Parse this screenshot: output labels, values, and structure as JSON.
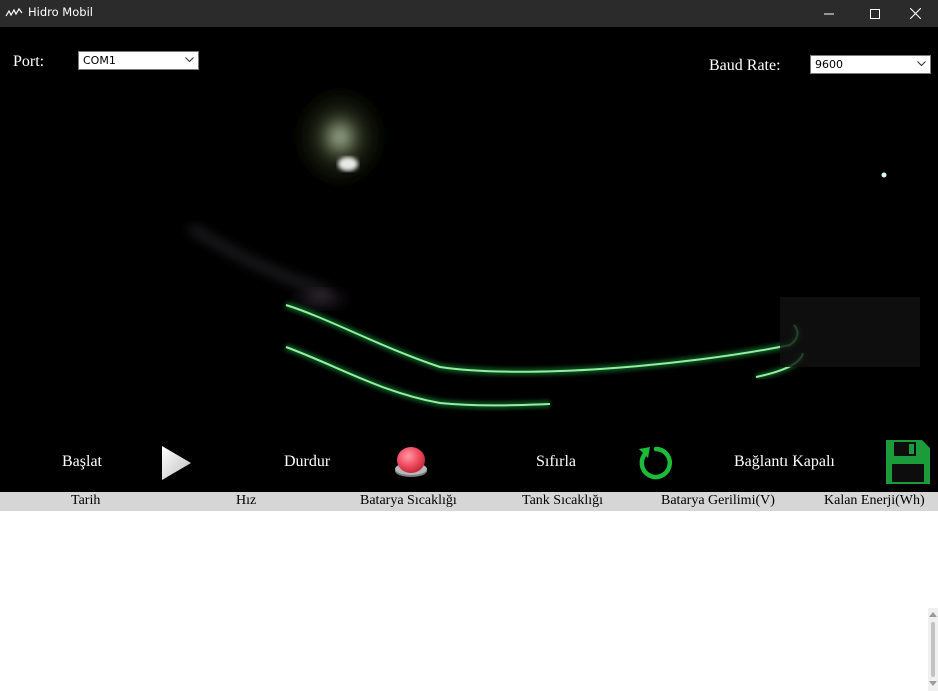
{
  "window": {
    "title": "Hidro Mobil",
    "controls": [
      "minimize-icon",
      "maximize-icon",
      "close-icon"
    ]
  },
  "connection": {
    "port_label": "Port:",
    "port_value": "COM1",
    "baud_label": "Baud Rate:",
    "baud_value": "9600"
  },
  "actions": {
    "start_label": "Başlat",
    "stop_label": "Durdur",
    "reset_label": "Sıfırla",
    "connection_status": "Bağlantı Kapalı",
    "icons": {
      "start": "play-icon",
      "stop": "stop-button-icon",
      "reset": "refresh-icon",
      "save": "save-icon"
    }
  },
  "table": {
    "columns": [
      "Tarih",
      "Hız",
      "Batarya Sıcaklığı",
      "Tank Sıcaklığı",
      "Batarya Gerilimi(V)",
      "Kalan Enerji(Wh)"
    ],
    "rows": []
  },
  "colors": {
    "titlebar": "#2b2b2b",
    "background": "#000000",
    "accent_green": "#22c34a",
    "stop_red": "#f15a6a",
    "header_gray": "#d6d6d6"
  }
}
